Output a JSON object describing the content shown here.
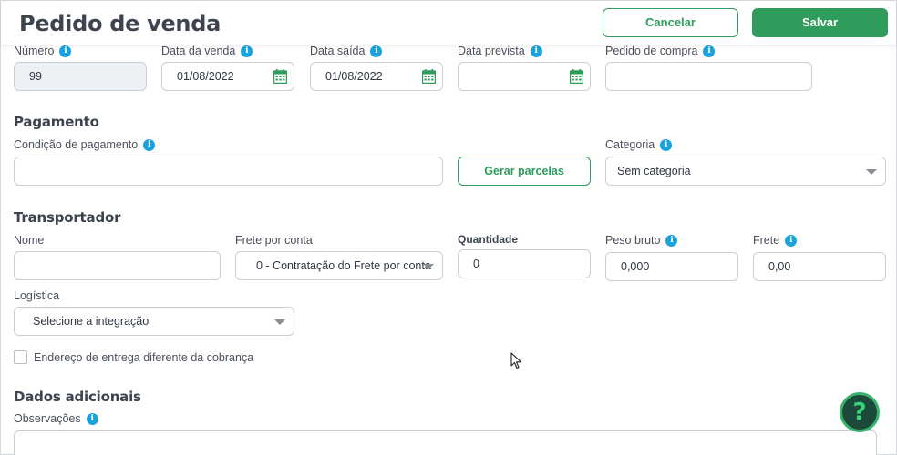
{
  "header": {
    "title": "Pedido de venda",
    "cancel_label": "Cancelar",
    "save_label": "Salvar"
  },
  "order": {
    "numero_label": "Número",
    "numero_value": "99",
    "data_venda_label": "Data da venda",
    "data_venda_value": "01/08/2022",
    "data_saida_label": "Data saída",
    "data_saida_value": "01/08/2022",
    "data_prevista_label": "Data prevista",
    "data_prevista_value": "",
    "pedido_compra_label": "Pedido de compra",
    "pedido_compra_value": ""
  },
  "pagamento": {
    "title": "Pagamento",
    "condicao_label": "Condição de pagamento",
    "condicao_value": "",
    "gerar_parcelas_label": "Gerar parcelas",
    "categoria_label": "Categoria",
    "categoria_value": "Sem categoria"
  },
  "transportador": {
    "title": "Transportador",
    "nome_label": "Nome",
    "nome_value": "",
    "frete_conta_label": "Frete por conta",
    "frete_conta_value": "0 - Contratação do Frete por conta",
    "quantidade_label": "Quantidade",
    "quantidade_value": "0",
    "peso_bruto_label": "Peso bruto",
    "peso_bruto_value": "0,000",
    "frete_label": "Frete",
    "frete_value": "0,00",
    "logistica_label": "Logística",
    "logistica_value": "Selecione a integração",
    "endereco_checkbox_label": "Endereço de entrega diferente da cobrança"
  },
  "dados_adicionais": {
    "title": "Dados adicionais",
    "observacoes_label": "Observações"
  },
  "help": {
    "symbol": "?"
  },
  "colors": {
    "primary_green": "#2f9c5b",
    "info_blue": "#1aa2dc",
    "help_bg": "#1c4a3a"
  },
  "icons": [
    "info-icon",
    "calendar-icon",
    "chevron-down-icon",
    "help-icon",
    "mouse-cursor"
  ]
}
